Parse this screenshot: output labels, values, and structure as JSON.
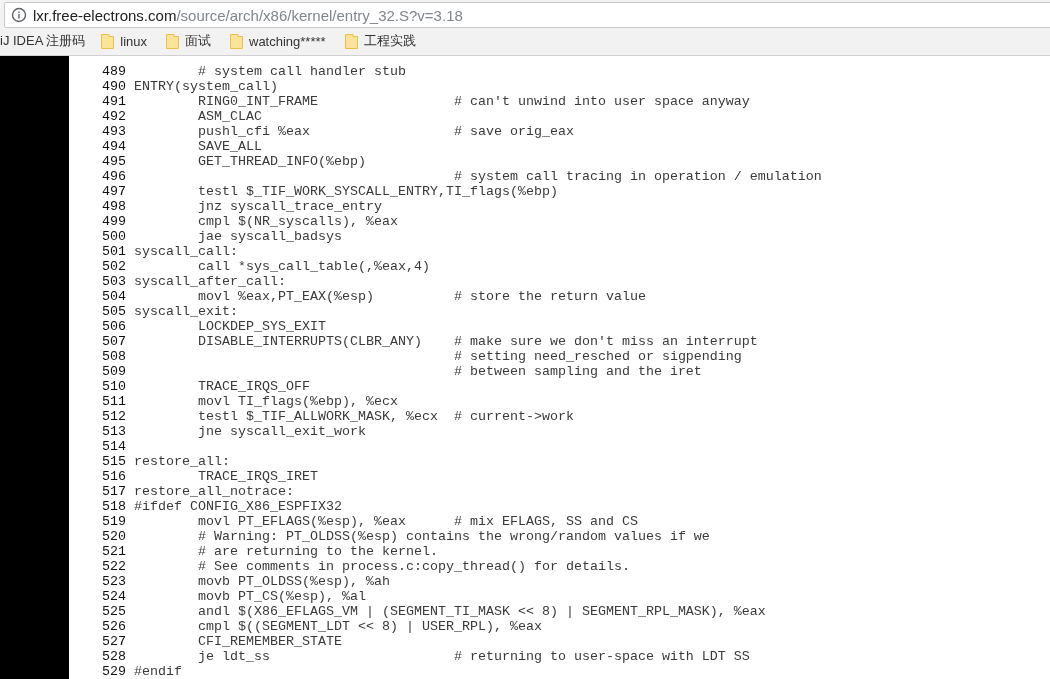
{
  "address_bar": {
    "host": "lxr.free-electrons.com",
    "path": "/source/arch/x86/kernel/entry_32.S?v=3.18"
  },
  "bookmarks": [
    {
      "label": "iJ IDEA 注册码",
      "kind": "link"
    },
    {
      "label": "linux",
      "kind": "folder"
    },
    {
      "label": "面试",
      "kind": "folder"
    },
    {
      "label": "watching*****",
      "kind": "folder"
    },
    {
      "label": "工程实践",
      "kind": "folder"
    }
  ],
  "source_lines": [
    {
      "number": "489",
      "code": "        # system call handler stub"
    },
    {
      "number": "490",
      "code": "ENTRY(system_call)"
    },
    {
      "number": "491",
      "code": "        RING0_INT_FRAME                 # can't unwind into user space anyway"
    },
    {
      "number": "492",
      "code": "        ASM_CLAC"
    },
    {
      "number": "493",
      "code": "        pushl_cfi %eax                  # save orig_eax"
    },
    {
      "number": "494",
      "code": "        SAVE_ALL"
    },
    {
      "number": "495",
      "code": "        GET_THREAD_INFO(%ebp)"
    },
    {
      "number": "496",
      "code": "                                        # system call tracing in operation / emulation"
    },
    {
      "number": "497",
      "code": "        testl $_TIF_WORK_SYSCALL_ENTRY,TI_flags(%ebp)"
    },
    {
      "number": "498",
      "code": "        jnz syscall_trace_entry"
    },
    {
      "number": "499",
      "code": "        cmpl $(NR_syscalls), %eax"
    },
    {
      "number": "500",
      "code": "        jae syscall_badsys"
    },
    {
      "number": "501",
      "code": "syscall_call:"
    },
    {
      "number": "502",
      "code": "        call *sys_call_table(,%eax,4)"
    },
    {
      "number": "503",
      "code": "syscall_after_call:"
    },
    {
      "number": "504",
      "code": "        movl %eax,PT_EAX(%esp)          # store the return value"
    },
    {
      "number": "505",
      "code": "syscall_exit:"
    },
    {
      "number": "506",
      "code": "        LOCKDEP_SYS_EXIT"
    },
    {
      "number": "507",
      "code": "        DISABLE_INTERRUPTS(CLBR_ANY)    # make sure we don't miss an interrupt"
    },
    {
      "number": "508",
      "code": "                                        # setting need_resched or sigpending"
    },
    {
      "number": "509",
      "code": "                                        # between sampling and the iret"
    },
    {
      "number": "510",
      "code": "        TRACE_IRQS_OFF"
    },
    {
      "number": "511",
      "code": "        movl TI_flags(%ebp), %ecx"
    },
    {
      "number": "512",
      "code": "        testl $_TIF_ALLWORK_MASK, %ecx  # current->work"
    },
    {
      "number": "513",
      "code": "        jne syscall_exit_work"
    },
    {
      "number": "514"
    },
    {
      "number": "515",
      "code": "restore_all:"
    },
    {
      "number": "516",
      "code": "        TRACE_IRQS_IRET"
    },
    {
      "number": "517",
      "code": "restore_all_notrace:"
    },
    {
      "number": "518",
      "code": "#ifdef CONFIG_X86_ESPFIX32"
    },
    {
      "number": "519",
      "code": "        movl PT_EFLAGS(%esp), %eax      # mix EFLAGS, SS and CS"
    },
    {
      "number": "520",
      "code": "        # Warning: PT_OLDSS(%esp) contains the wrong/random values if we"
    },
    {
      "number": "521",
      "code": "        # are returning to the kernel."
    },
    {
      "number": "522",
      "code": "        # See comments in process.c:copy_thread() for details."
    },
    {
      "number": "523",
      "code": "        movb PT_OLDSS(%esp), %ah"
    },
    {
      "number": "524",
      "code": "        movb PT_CS(%esp), %al"
    },
    {
      "number": "525",
      "code": "        andl $(X86_EFLAGS_VM | (SEGMENT_TI_MASK << 8) | SEGMENT_RPL_MASK), %eax"
    },
    {
      "number": "526",
      "code": "        cmpl $((SEGMENT_LDT << 8) | USER_RPL), %eax"
    },
    {
      "number": "527",
      "code": "        CFI_REMEMBER_STATE"
    },
    {
      "number": "528",
      "code": "        je ldt_ss                       # returning to user-space with LDT SS"
    },
    {
      "number": "529",
      "code": "#endif"
    }
  ]
}
